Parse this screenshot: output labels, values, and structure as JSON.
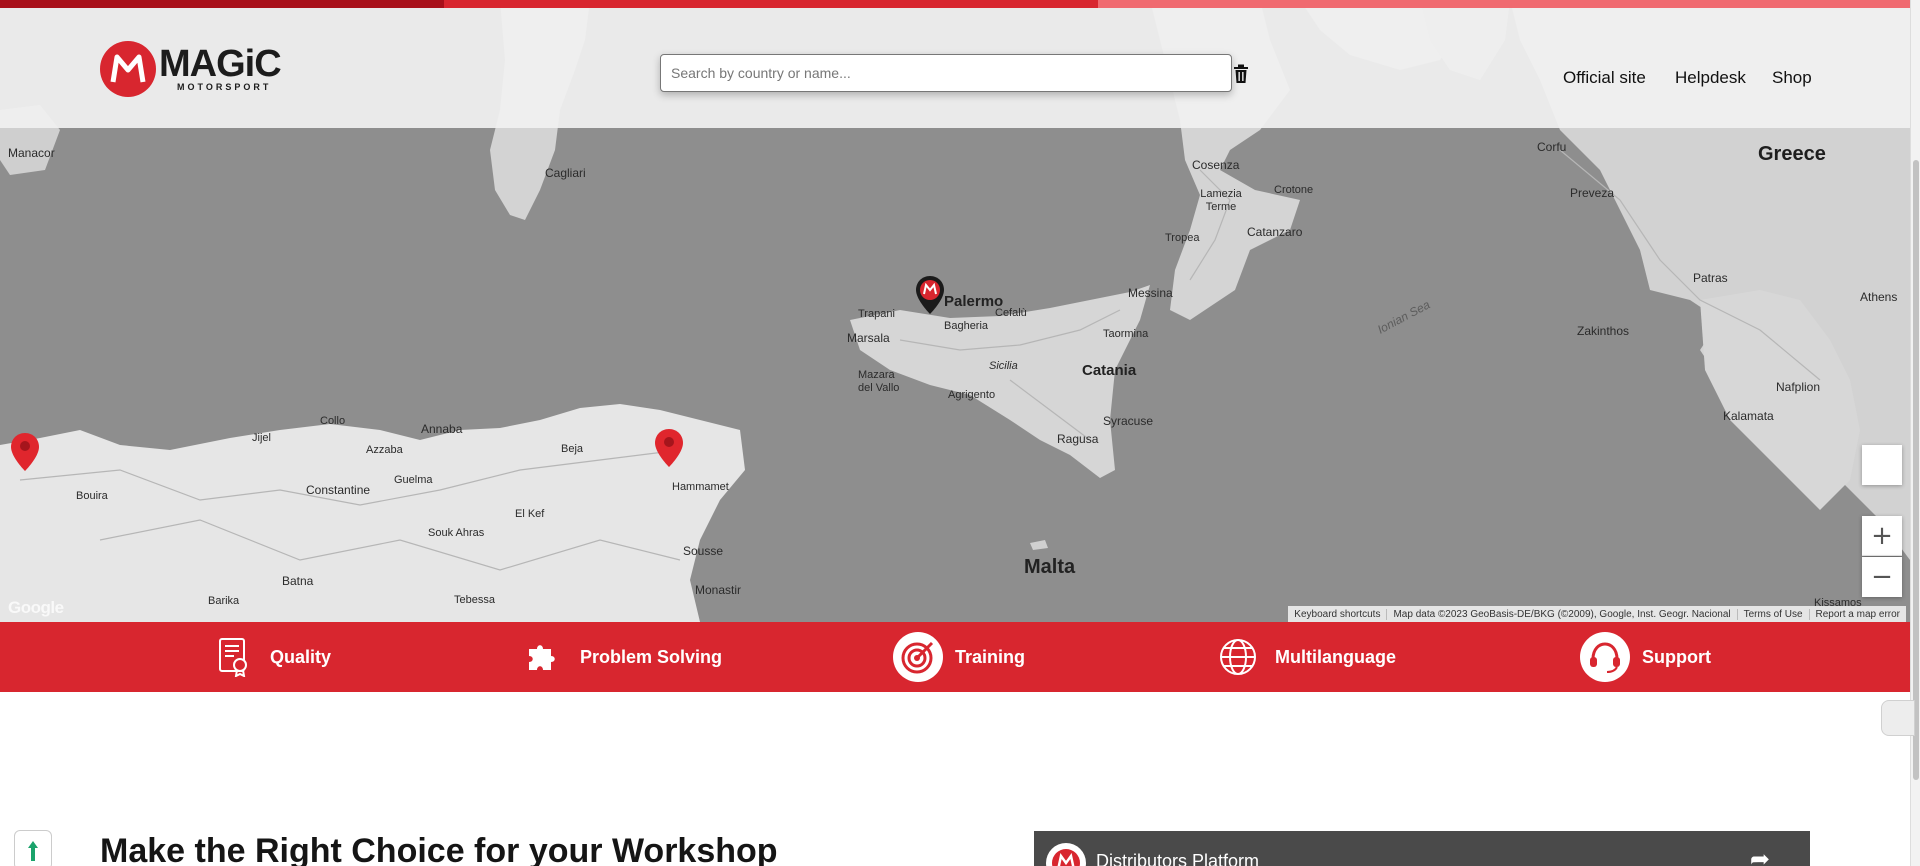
{
  "header": {
    "logo_main": "MAGiC",
    "logo_sub": "MOTORSPORT",
    "search_placeholder": "Search by country or name...",
    "nav": [
      "Official site",
      "Helpdesk",
      "Shop"
    ]
  },
  "map": {
    "labels": {
      "greece": "Greece",
      "malta": "Malta",
      "catania": "Catania",
      "palermo": "Palermo",
      "cagliari": "Cagliari",
      "cosenza": "Cosenza",
      "lamezia": "Lamezia Terme",
      "crotone": "Crotone",
      "catanzaro": "Catanzaro",
      "tropea": "Tropea",
      "messina": "Messina",
      "taormina": "Taormina",
      "trapani": "Trapani",
      "bagheria": "Bagheria",
      "cefalu": "Cefalù",
      "marsala": "Marsala",
      "mazara": "Mazara del Vallo",
      "sicilia": "Sicilia",
      "agrigento": "Agrigento",
      "syracuse": "Syracuse",
      "ragusa": "Ragusa",
      "ionian": "Ionian Sea",
      "patras": "Patras",
      "preveza": "Preveza",
      "corfu": "Corfu",
      "zakinthos": "Zakinthos",
      "nafplion": "Nafplion",
      "kalamata": "Kalamata",
      "constantine": "Constantine",
      "annaba": "Annaba",
      "batna": "Batna",
      "sousse": "Sousse",
      "monastir": "Monastir",
      "hammamet": "Hammamet",
      "beja": "Beja",
      "elkef": "El Kef",
      "tebessa": "Tebessa",
      "souk_ahras": "Souk Ahras",
      "guelma": "Guelma",
      "bouira": "Bouira",
      "jijel": "Jijel",
      "collo": "Collo",
      "azzaba": "Azzaba",
      "barika": "Barika",
      "manacor": "Manacor",
      "kissamos": "Kissamos",
      "athens": "Athens"
    },
    "attribution": [
      "Keyboard shortcuts",
      "Map data ©2023 GeoBasis-DE/BKG (©2009), Google, Inst. Geogr. Nacional",
      "Terms of Use",
      "Report a map error"
    ],
    "google": "Google",
    "zoom_in": "+",
    "zoom_out": "−"
  },
  "features": [
    {
      "label": "Quality",
      "icon": "certificate-icon"
    },
    {
      "label": "Problem Solving",
      "icon": "puzzle-icon"
    },
    {
      "label": "Training",
      "icon": "target-icon"
    },
    {
      "label": "Multilanguage",
      "icon": "globe-icon"
    },
    {
      "label": "Support",
      "icon": "headset-icon"
    }
  ],
  "content": {
    "title": "Make the Right Choice for your Workshop",
    "video_title": "Distributors Platform"
  },
  "colors": {
    "brand_red": "#d8262f",
    "map_water": "#8e8e8e"
  }
}
